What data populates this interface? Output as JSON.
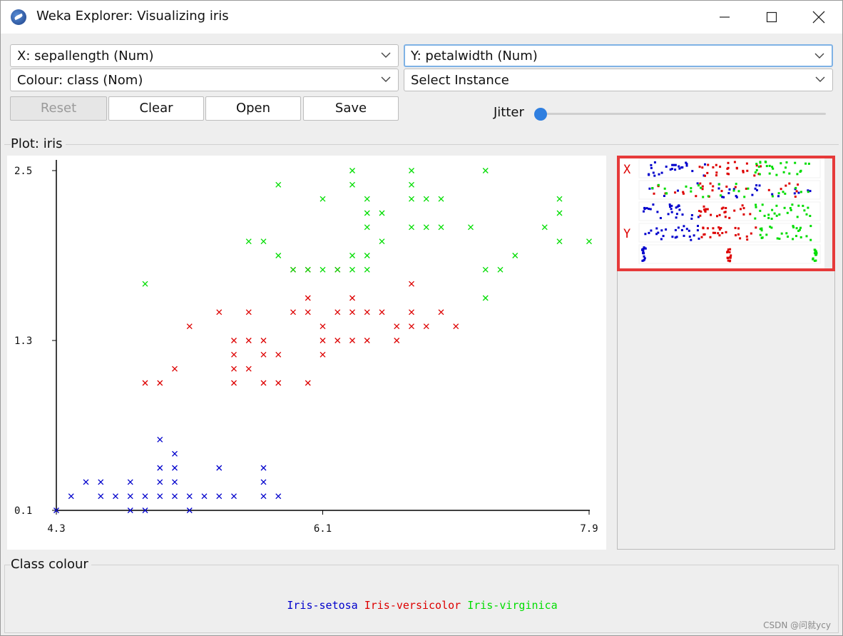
{
  "window": {
    "title": "Weka Explorer: Visualizing iris",
    "icon": "weka-bird-icon"
  },
  "controls": {
    "x_axis": "X: sepallength (Num)",
    "y_axis": "Y: petalwidth (Num)",
    "colour": "Colour: class (Nom)",
    "select_instance": "Select Instance",
    "reset_label": "Reset",
    "clear_label": "Clear",
    "open_label": "Open",
    "save_label": "Save",
    "jitter_label": "Jitter",
    "jitter_value": 0
  },
  "plot": {
    "title": "Plot: iris"
  },
  "matrix": {
    "x_label": "X",
    "y_label": "Y"
  },
  "class_colour": {
    "title": "Class colour",
    "classes": [
      {
        "name": "Iris-setosa",
        "color": "#0000cc"
      },
      {
        "name": "Iris-versicolor",
        "color": "#dd0000"
      },
      {
        "name": "Iris-virginica",
        "color": "#00dd00"
      }
    ]
  },
  "watermark": "CSDN @问就ycy",
  "colors": {
    "setosa": "#0000cc",
    "versicolor": "#dd0000",
    "virginica": "#00dd00",
    "highlight": "#e63a3a"
  },
  "chart_data": {
    "type": "scatter",
    "xlabel": "",
    "ylabel": "",
    "xlim": [
      4.3,
      7.9
    ],
    "ylim": [
      0.1,
      2.5
    ],
    "x_ticks": [
      "4.3",
      "6.1",
      "7.9"
    ],
    "y_ticks": [
      "0.1",
      "1.3",
      "2.5"
    ],
    "series": [
      {
        "name": "Iris-setosa",
        "color": "#0000cc",
        "points": [
          [
            4.3,
            0.1
          ],
          [
            4.4,
            0.2
          ],
          [
            4.5,
            0.3
          ],
          [
            4.6,
            0.2
          ],
          [
            4.6,
            0.3
          ],
          [
            4.7,
            0.2
          ],
          [
            4.8,
            0.1
          ],
          [
            4.8,
            0.2
          ],
          [
            4.8,
            0.3
          ],
          [
            4.9,
            0.1
          ],
          [
            4.9,
            0.2
          ],
          [
            5.0,
            0.2
          ],
          [
            5.0,
            0.3
          ],
          [
            5.0,
            0.4
          ],
          [
            5.0,
            0.6
          ],
          [
            5.1,
            0.2
          ],
          [
            5.1,
            0.3
          ],
          [
            5.1,
            0.4
          ],
          [
            5.1,
            0.5
          ],
          [
            5.2,
            0.1
          ],
          [
            5.2,
            0.2
          ],
          [
            5.3,
            0.2
          ],
          [
            5.4,
            0.2
          ],
          [
            5.4,
            0.4
          ],
          [
            5.5,
            0.2
          ],
          [
            5.7,
            0.2
          ],
          [
            5.7,
            0.3
          ],
          [
            5.7,
            0.4
          ],
          [
            5.8,
            0.2
          ]
        ]
      },
      {
        "name": "Iris-versicolor",
        "color": "#dd0000",
        "points": [
          [
            4.9,
            1.0
          ],
          [
            5.0,
            1.0
          ],
          [
            5.1,
            1.1
          ],
          [
            5.2,
            1.4
          ],
          [
            5.4,
            1.5
          ],
          [
            5.5,
            1.0
          ],
          [
            5.5,
            1.1
          ],
          [
            5.5,
            1.2
          ],
          [
            5.5,
            1.3
          ],
          [
            5.6,
            1.1
          ],
          [
            5.6,
            1.3
          ],
          [
            5.6,
            1.5
          ],
          [
            5.7,
            1.0
          ],
          [
            5.7,
            1.2
          ],
          [
            5.7,
            1.3
          ],
          [
            5.8,
            1.0
          ],
          [
            5.8,
            1.2
          ],
          [
            5.9,
            1.5
          ],
          [
            5.9,
            1.8
          ],
          [
            6.0,
            1.0
          ],
          [
            6.0,
            1.5
          ],
          [
            6.0,
            1.6
          ],
          [
            6.0,
            1.8
          ],
          [
            6.1,
            1.2
          ],
          [
            6.1,
            1.3
          ],
          [
            6.1,
            1.4
          ],
          [
            6.2,
            1.3
          ],
          [
            6.2,
            1.5
          ],
          [
            6.2,
            1.8
          ],
          [
            6.3,
            1.3
          ],
          [
            6.3,
            1.5
          ],
          [
            6.3,
            1.6
          ],
          [
            6.4,
            1.3
          ],
          [
            6.4,
            1.5
          ],
          [
            6.5,
            1.5
          ],
          [
            6.6,
            1.3
          ],
          [
            6.6,
            1.4
          ],
          [
            6.7,
            1.4
          ],
          [
            6.7,
            1.5
          ],
          [
            6.7,
            1.7
          ],
          [
            6.8,
            1.4
          ],
          [
            6.9,
            1.5
          ],
          [
            7.0,
            1.4
          ]
        ]
      },
      {
        "name": "Iris-virginica",
        "color": "#00dd00",
        "points": [
          [
            4.9,
            1.7
          ],
          [
            5.6,
            2.0
          ],
          [
            5.7,
            2.0
          ],
          [
            5.8,
            1.9
          ],
          [
            5.8,
            2.4
          ],
          [
            5.9,
            1.8
          ],
          [
            6.0,
            1.8
          ],
          [
            6.1,
            1.8
          ],
          [
            6.1,
            2.3
          ],
          [
            6.2,
            1.8
          ],
          [
            6.3,
            1.8
          ],
          [
            6.3,
            1.9
          ],
          [
            6.3,
            2.5
          ],
          [
            6.3,
            2.4
          ],
          [
            6.4,
            1.8
          ],
          [
            6.4,
            1.9
          ],
          [
            6.4,
            2.1
          ],
          [
            6.4,
            2.2
          ],
          [
            6.4,
            2.3
          ],
          [
            6.5,
            2.0
          ],
          [
            6.5,
            2.2
          ],
          [
            6.7,
            2.1
          ],
          [
            6.7,
            2.3
          ],
          [
            6.7,
            2.4
          ],
          [
            6.7,
            2.5
          ],
          [
            6.8,
            2.1
          ],
          [
            6.8,
            2.3
          ],
          [
            6.9,
            2.1
          ],
          [
            6.9,
            2.3
          ],
          [
            7.1,
            2.1
          ],
          [
            7.2,
            1.6
          ],
          [
            7.2,
            1.8
          ],
          [
            7.2,
            2.5
          ],
          [
            7.3,
            1.8
          ],
          [
            7.4,
            1.9
          ],
          [
            7.6,
            2.1
          ],
          [
            7.7,
            2.0
          ],
          [
            7.7,
            2.2
          ],
          [
            7.7,
            2.3
          ],
          [
            7.9,
            2.0
          ]
        ]
      }
    ]
  }
}
